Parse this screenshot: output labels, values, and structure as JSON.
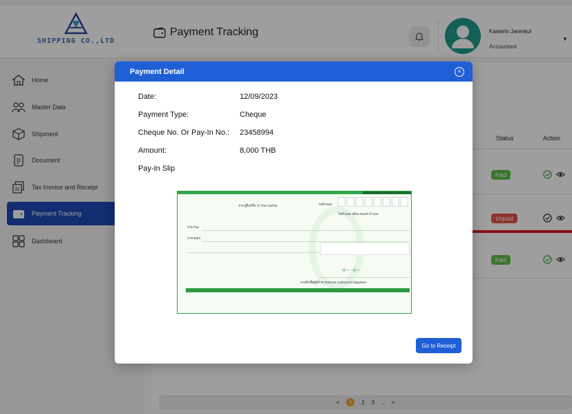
{
  "header": {
    "logo_text": "SHIPPING CO.,LTD",
    "page_title": "Payment Tracking",
    "user_name": "Kawarin Jarenkul",
    "user_role": "Accountant"
  },
  "sidebar": {
    "items": [
      {
        "label": "Home",
        "icon": "home-icon"
      },
      {
        "label": "Master Data",
        "icon": "users-icon"
      },
      {
        "label": "Shipment",
        "icon": "box-icon"
      },
      {
        "label": "Document",
        "icon": "document-icon"
      },
      {
        "label": "Tax Invoice and Receipt",
        "icon": "receipt-icon"
      },
      {
        "label": "Payment Tracking",
        "icon": "wallet-icon",
        "active": true
      },
      {
        "label": "Dashboard",
        "icon": "dashboard-icon"
      }
    ]
  },
  "table": {
    "headers": {
      "status": "Status",
      "action": "Action"
    },
    "rows": [
      {
        "status": "Paid"
      },
      {
        "status": "Unpaid"
      },
      {
        "status": "Paid"
      }
    ]
  },
  "pagination": {
    "prev": "<",
    "pages": [
      "1",
      "2",
      "3",
      ".."
    ],
    "next": ">",
    "current": "1"
  },
  "modal": {
    "title": "Payment Detail",
    "fields": [
      {
        "label": "Date:",
        "value": "12/09/2023"
      },
      {
        "label": "Payment Type:",
        "value": "Cheque"
      },
      {
        "label": "Cheque No. Or Pay-In No.:",
        "value": "23458994"
      },
      {
        "label": "Amount:",
        "value": "8,000 THB"
      }
    ],
    "slip_label": "Pay-In Slip",
    "cheque": {
      "payee": "จ่าย Pay",
      "baht": "บาท Baht",
      "cashier": "จ่าย ผู้ถือหรือ To The Cashier",
      "date_label": "วันที่ Date",
      "day_month_year": "วันที่ Date   เดือน Month   ปี Year",
      "authorized": "ลายมือชื่อผู้มีอำนาจลงนาม   Authorized  Signature"
    },
    "go_button": "Go to Receipt"
  },
  "colors": {
    "primary": "#1f5fd6",
    "active_nav": "#1f4ab8",
    "paid": "#5fbf4a",
    "unpaid": "#e5534b",
    "avatar": "#1f9b8f"
  }
}
